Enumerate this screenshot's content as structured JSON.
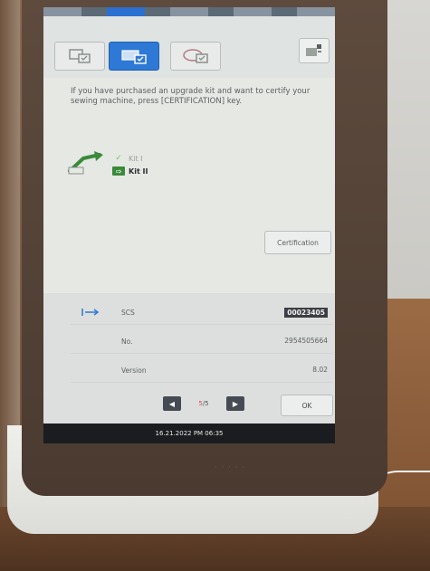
{
  "toolbar": {
    "tabs": [
      {
        "name": "tab-machine-settings"
      },
      {
        "name": "tab-general-settings"
      },
      {
        "name": "tab-embroidery-settings"
      }
    ]
  },
  "message": "If you have purchased an upgrade kit and want to certify your sewing machine, press [CERTIFICATION] key.",
  "kits": [
    {
      "label": "Kit I",
      "status": "done"
    },
    {
      "label": "Kit II",
      "status": "current"
    }
  ],
  "certification_label": "Certification",
  "info": {
    "scs_label": "SCS",
    "scs_value": "00023405",
    "no_label": "No.",
    "no_value": "2954505664",
    "version_label": "Version",
    "version_value": "8.02"
  },
  "pager": {
    "current": "5",
    "separator": "/",
    "total": "5"
  },
  "ok_label": "OK",
  "status": {
    "datetime": "16.21.2022 PM 06:35"
  },
  "colors": {
    "accent": "#2e79d6",
    "kit_green": "#3a8a3a"
  }
}
